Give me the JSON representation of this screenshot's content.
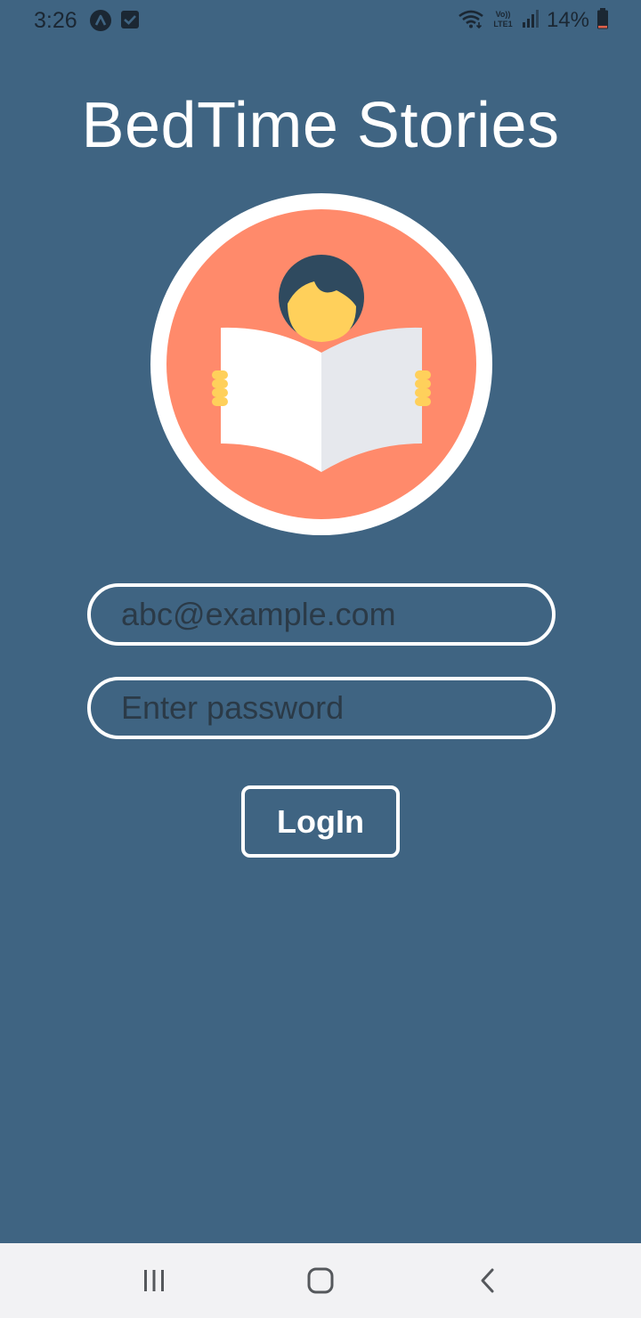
{
  "status_bar": {
    "time": "3:26",
    "battery_percent": "14%",
    "icons": [
      "app-a-icon",
      "check-square-icon",
      "wifi-icon",
      "volte-icon",
      "signal-icon",
      "battery-icon"
    ],
    "battery_level": 0.14
  },
  "title": "BedTime Stories",
  "logo": {
    "icon": "reading-child-book-icon",
    "colors": {
      "ring": "#ffffff",
      "circle": "#ff8a6b",
      "hair": "#2f4a5f",
      "face": "#ffd05b",
      "page_left": "#ffffff",
      "page_right": "#e6e8ed"
    }
  },
  "form": {
    "email_placeholder": "abc@example.com",
    "password_placeholder": "Enter password",
    "login_label": "LogIn"
  },
  "nav_bar": {
    "icons": [
      "recent-apps-icon",
      "home-icon",
      "back-icon"
    ]
  },
  "colors": {
    "background": "#3f6482",
    "accent": "#ffffff",
    "nav_background": "#f2f2f4"
  }
}
